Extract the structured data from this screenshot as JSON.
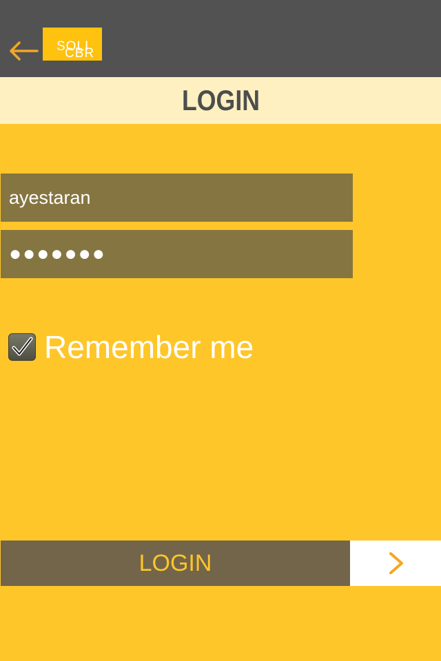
{
  "header": {
    "back_icon": "back-arrow-icon",
    "logo_line1": "SOLI",
    "logo_line2": "CBR"
  },
  "title": "LOGIN",
  "form": {
    "username_value": "ayestaran",
    "password_value": "●●●●●●●",
    "remember_checked": true,
    "remember_label": "Remember me"
  },
  "actions": {
    "login_label": "LOGIN",
    "go_icon": "chevron-right-icon"
  },
  "colors": {
    "background": "#ffc629",
    "topbar": "#525252",
    "accent": "#f5a623",
    "field": "#857541",
    "button": "#72654a"
  }
}
